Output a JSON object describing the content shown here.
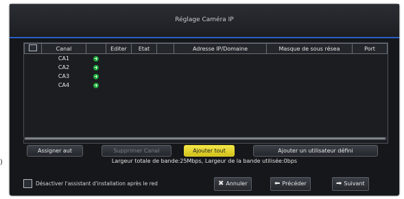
{
  "window": {
    "title": "Réglage Caméra IP"
  },
  "table": {
    "headers": [
      "Canal",
      "Editer",
      "Etat",
      "Adresse IP/Domaine",
      "Masque de sous résea",
      "Port"
    ],
    "rows": [
      {
        "canal": "CA1",
        "add_icon": "plus-circle-icon"
      },
      {
        "canal": "CA2",
        "add_icon": "plus-circle-icon"
      },
      {
        "canal": "CA3",
        "add_icon": "plus-circle-icon"
      },
      {
        "canal": "CA4",
        "add_icon": "plus-circle-icon"
      }
    ]
  },
  "buttons": {
    "assign": "Assigner aut",
    "delete": "Supprimer Canal",
    "add_all": "Ajouter tout",
    "add_user_defined": "Ajouter un utilisateur défini"
  },
  "bandwidth": {
    "text": "Largeur totale de bande:25Mbps,  Largeur de la bande utilisée:0bps"
  },
  "footer": {
    "checkbox_label": "Désactiver l'assistant d'installation après le red",
    "cancel": "Annuler",
    "prev": "Précéder",
    "next": "Suivant"
  },
  "edge_text": ")",
  "colors": {
    "accent": "#2a5fc9",
    "active_button": "#f2e64a",
    "plus_icon": "#1fa83a"
  }
}
